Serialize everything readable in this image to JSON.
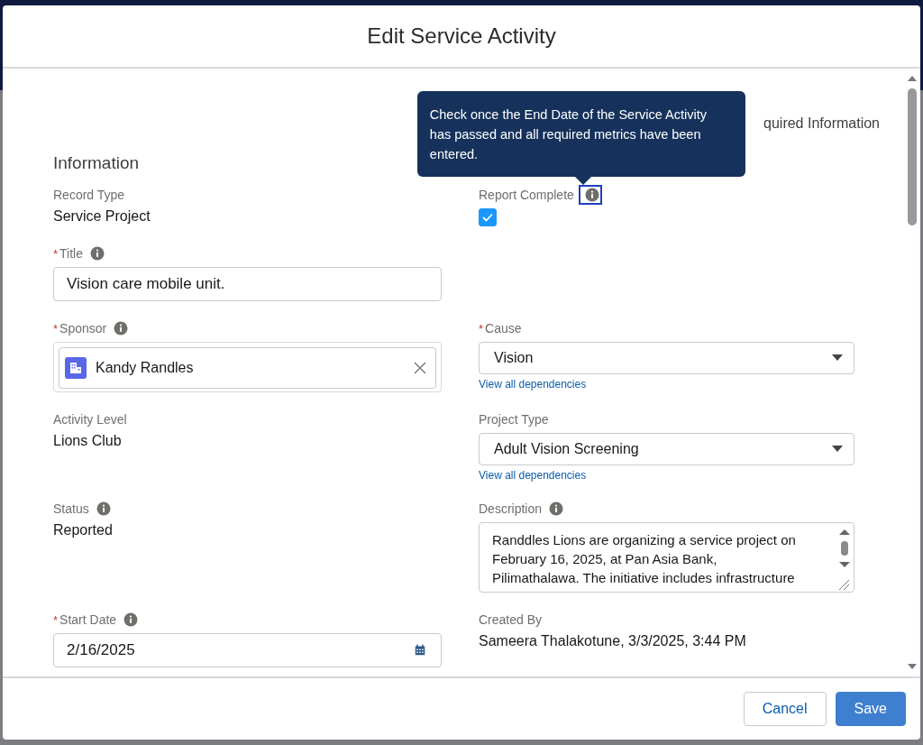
{
  "modal": {
    "title": "Edit Service Activity"
  },
  "required_legend": "quired Information",
  "section": "Information",
  "rows": [
    {
      "left": {
        "kind": "output",
        "label": "Record Type",
        "value": "Service Project"
      },
      "right": {
        "kind": "checkbox",
        "label": "Report Complete",
        "help": true,
        "help_focused": true,
        "checked": true,
        "tooltip": "Check once the End Date of the Service Activity has passed and all required metrics have been entered."
      }
    },
    {
      "left": {
        "kind": "text",
        "label": "Title",
        "required_mark": "*",
        "help": true,
        "value": "Vision care mobile unit."
      }
    },
    {
      "left": {
        "kind": "lookup",
        "label": "Sponsor",
        "required_mark": "*",
        "help": true,
        "value": "Kandy Randles"
      },
      "right": {
        "kind": "picklist",
        "label": "Cause",
        "required_mark": "*",
        "value": "Vision",
        "link": "View all dependencies"
      }
    },
    {
      "left": {
        "kind": "output",
        "label": "Activity Level",
        "value": "Lions Club"
      },
      "right": {
        "kind": "picklist",
        "label": "Project Type",
        "value": "Adult Vision Screening",
        "link": "View all dependencies"
      }
    },
    {
      "left": {
        "kind": "output",
        "label": "Status",
        "help": true,
        "value": "Reported"
      },
      "right": {
        "kind": "textarea",
        "label": "Description",
        "help": true,
        "lines": [
          "Randdles Lions are organizing a service project on",
          "February 16, 2025, at Pan Asia Bank,",
          "Pilimathalawa. The initiative includes infrastructure"
        ]
      }
    },
    {
      "left": {
        "kind": "date",
        "label": "Start Date",
        "required_mark": "*",
        "help": true,
        "value": "2/16/2025"
      },
      "right": {
        "kind": "output",
        "label": "Created By",
        "value": "Sameera Thalakotune, 3/3/2025, 3:44 PM"
      }
    }
  ],
  "buttons": [
    {
      "label": "Cancel",
      "kind": "neutral"
    },
    {
      "label": "Save",
      "kind": "brand"
    }
  ]
}
